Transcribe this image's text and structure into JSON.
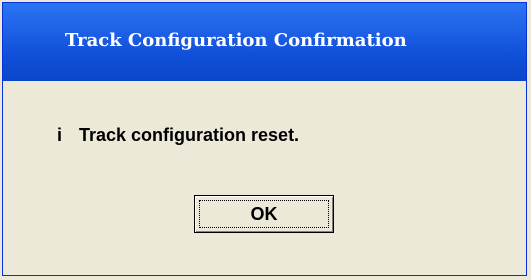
{
  "dialog": {
    "title": "Track Configuration Confirmation",
    "icon": "info-icon",
    "icon_glyph": "i",
    "message": "Track configuration reset.",
    "ok_label": "OK"
  },
  "colors": {
    "titlebar": "#1d5ee6",
    "titlebar_border": "#0831d9",
    "background": "#ece9d8",
    "text": "#000000",
    "title_text": "#ffffff"
  }
}
